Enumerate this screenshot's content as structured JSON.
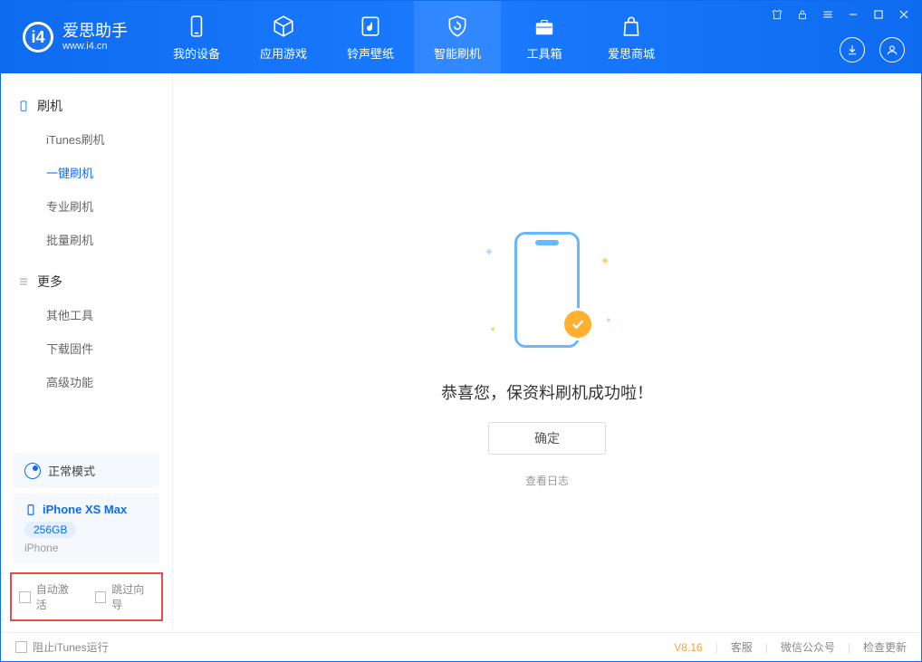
{
  "app": {
    "title": "爱思助手",
    "subtitle": "www.i4.cn"
  },
  "header_tabs": [
    {
      "label": "我的设备"
    },
    {
      "label": "应用游戏"
    },
    {
      "label": "铃声壁纸"
    },
    {
      "label": "智能刷机"
    },
    {
      "label": "工具箱"
    },
    {
      "label": "爱思商城"
    }
  ],
  "sidebar": {
    "group1": {
      "title": "刷机",
      "items": [
        "iTunes刷机",
        "一键刷机",
        "专业刷机",
        "批量刷机"
      ],
      "active_index": 1
    },
    "group2": {
      "title": "更多",
      "items": [
        "其他工具",
        "下载固件",
        "高级功能"
      ]
    },
    "mode": "正常模式",
    "device": {
      "name": "iPhone XS Max",
      "storage": "256GB",
      "type": "iPhone"
    },
    "checkboxes": {
      "auto_activate": "自动激活",
      "skip_guide": "跳过向导"
    }
  },
  "main": {
    "success_text": "恭喜您，保资料刷机成功啦！",
    "ok_button": "确定",
    "view_log": "查看日志"
  },
  "footer": {
    "block_itunes": "阻止iTunes运行",
    "version": "V8.16",
    "service": "客服",
    "wechat": "微信公众号",
    "check_update": "检查更新"
  }
}
